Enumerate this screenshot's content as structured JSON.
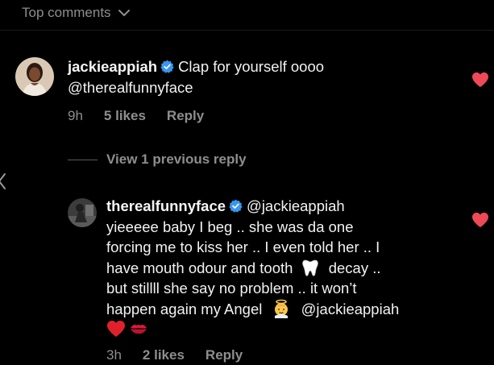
{
  "header": {
    "sort_label": "Top comments"
  },
  "comments": [
    {
      "username": "jackieappiah",
      "text": "Clap for yourself oooo",
      "mention": "@therealfunnyface",
      "time": "9h",
      "likes": "5 likes",
      "reply_label": "Reply"
    }
  ],
  "view_replies_label": "View 1 previous reply",
  "reply": {
    "username": "therealfunnyface",
    "mention_start": "@jackieappiah",
    "line1": "yieeeee baby I beg .. she was da one",
    "line2": "forcing me to kiss her .. I even told her .. I",
    "line3a": "have mouth odour and tooth",
    "line3b": "decay ..",
    "line4": "but stillll she say no problem .. it won’t",
    "line5a": "happen again my Angel",
    "line5b": "@jackieappiah",
    "time": "3h",
    "likes": "2 likes",
    "reply_label": "Reply"
  },
  "icons": {
    "verified": "verified-badge-icon",
    "heart": "heart-icon",
    "chevron": "chevron-down-icon",
    "tooth": "tooth-emoji",
    "angel": "baby-angel-emoji",
    "red_heart": "red-heart-emoji",
    "kiss": "kiss-mark-emoji"
  },
  "colors": {
    "background": "#000000",
    "text": "#f5f5f5",
    "muted": "#8e8e8e",
    "heart": "#ed4956",
    "verified": "#3897f0"
  }
}
